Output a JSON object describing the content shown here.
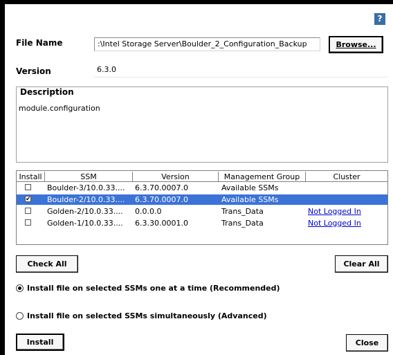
{
  "help_label": "?",
  "file_name": {
    "label": "File Name",
    "value": ":\\Intel Storage Server\\Boulder_2_Configuration_Backup",
    "browse_label": "Browse..."
  },
  "version": {
    "label": "Version",
    "value": "6.3.0"
  },
  "description": {
    "title": "Description",
    "text": "module.configuration"
  },
  "table": {
    "columns": [
      "Install",
      "SSM",
      "Version",
      "Management Group",
      "Cluster"
    ],
    "rows": [
      {
        "checked": false,
        "ssm": "Boulder-3/10.0.33....",
        "version": "6.3.70.0007.0",
        "group": "Available SSMs",
        "cluster": ""
      },
      {
        "checked": true,
        "ssm": "Boulder-2/10.0.33....",
        "version": "6.3.70.0007.0",
        "group": "Available SSMs",
        "cluster": ""
      },
      {
        "checked": false,
        "ssm": "Golden-2/10.0.33....",
        "version": "0.0.0.0",
        "group": "Trans_Data",
        "cluster": "Not Logged In"
      },
      {
        "checked": false,
        "ssm": "Golden-1/10.0.33....",
        "version": "6.3.30.0001.0",
        "group": "Trans_Data",
        "cluster": "Not Logged In"
      }
    ],
    "selected_row": 1
  },
  "buttons": {
    "check_all": "Check All",
    "clear_all": "Clear All",
    "install": "Install",
    "close": "Close"
  },
  "options": {
    "one_at_a_time": "Install file on selected SSMs one at a time (Recommended)",
    "simultaneously": "Install file on selected SSMs simultaneously (Advanced)",
    "selected": "one_at_a_time"
  },
  "colors": {
    "selection": "#3b73d6",
    "link": "#0000cc",
    "help_icon": "#3a6ea5"
  }
}
